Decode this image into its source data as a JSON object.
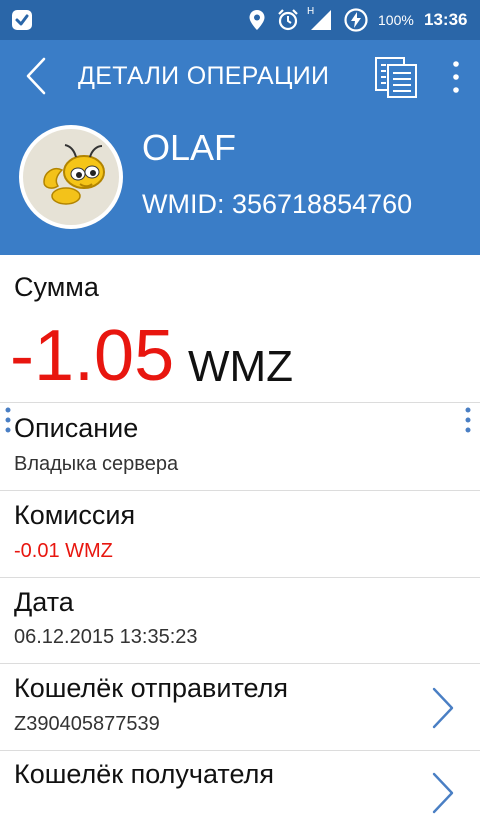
{
  "status_bar": {
    "battery": "100%",
    "time": "13:36",
    "network_type": "H",
    "icons": [
      "app-notification-icon",
      "location-icon",
      "alarm-icon",
      "signal-icon",
      "charging-icon"
    ]
  },
  "app_bar": {
    "title": "ДЕТАЛИ ОПЕРАЦИИ",
    "icons": [
      "back-icon",
      "copy-document-icon",
      "overflow-menu-icon"
    ]
  },
  "header": {
    "name": "OLAF",
    "wmid": "WMID: 356718854760",
    "avatar_icon": "webmoney-ant-icon"
  },
  "amount": {
    "label": "Сумма",
    "value": "-1.05",
    "currency": "WMZ"
  },
  "details": [
    {
      "label": "Описание",
      "value": "Владыка сервера"
    },
    {
      "label": "Комиссия",
      "value": "-0.01 WMZ"
    },
    {
      "label": "Дата",
      "value": "06.12.2015 13:35:23"
    },
    {
      "label": "Кошелёк отправителя",
      "value": "Z390405877539"
    },
    {
      "label": "Кошелёк получателя",
      "value": ""
    }
  ],
  "colors": {
    "primary": "#3a7dc7",
    "status_bar": "#2a66a8",
    "negative": "#e8160f",
    "chevron": "#4a7fc4"
  }
}
